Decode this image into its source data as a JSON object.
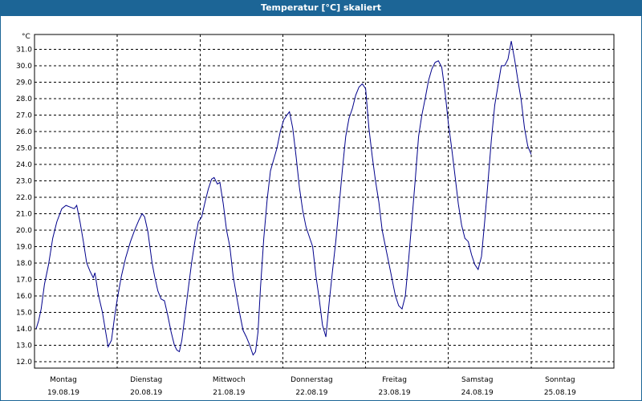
{
  "window": {
    "title": "Temperatur [°C] skaliert"
  },
  "chart_data": {
    "type": "line",
    "ylabel": "°C",
    "ylim": [
      11.6,
      31.9
    ],
    "xlim": [
      0,
      7
    ],
    "y_ticks": [
      "12.0",
      "13.0",
      "14.0",
      "15.0",
      "16.0",
      "17.0",
      "18.0",
      "19.0",
      "20.0",
      "21.0",
      "22.0",
      "23.0",
      "24.0",
      "25.0",
      "26.0",
      "27.0",
      "28.0",
      "29.0",
      "30.0",
      "31.0"
    ],
    "days": [
      {
        "weekday": "Montag",
        "date": "19.08.19"
      },
      {
        "weekday": "Dienstag",
        "date": "20.08.19"
      },
      {
        "weekday": "Mittwoch",
        "date": "21.08.19"
      },
      {
        "weekday": "Donnerstag",
        "date": "22.08.19"
      },
      {
        "weekday": "Freitag",
        "date": "23.08.19"
      },
      {
        "weekday": "Samstag",
        "date": "24.08.19"
      },
      {
        "weekday": "Sonntag",
        "date": "25.08.19"
      }
    ],
    "grid": true,
    "colors": {
      "line": "#00008b",
      "grid": "#000000",
      "frame": "#1c6596"
    },
    "series": [
      {
        "x_unit": "days since 19.08.19 00:00",
        "points": [
          [
            0.02,
            14.0
          ],
          [
            0.05,
            14.5
          ],
          [
            0.08,
            15.2
          ],
          [
            0.12,
            16.7
          ],
          [
            0.17,
            17.9
          ],
          [
            0.22,
            19.5
          ],
          [
            0.27,
            20.5
          ],
          [
            0.33,
            21.3
          ],
          [
            0.38,
            21.5
          ],
          [
            0.43,
            21.4
          ],
          [
            0.48,
            21.3
          ],
          [
            0.51,
            21.5
          ],
          [
            0.55,
            20.5
          ],
          [
            0.59,
            19.3
          ],
          [
            0.63,
            18.0
          ],
          [
            0.67,
            17.5
          ],
          [
            0.71,
            17.1
          ],
          [
            0.73,
            17.4
          ],
          [
            0.77,
            16.1
          ],
          [
            0.82,
            15.0
          ],
          [
            0.86,
            13.8
          ],
          [
            0.89,
            12.9
          ],
          [
            0.93,
            13.3
          ],
          [
            0.97,
            14.8
          ],
          [
            1.0,
            15.8
          ],
          [
            1.05,
            17.2
          ],
          [
            1.1,
            18.3
          ],
          [
            1.16,
            19.3
          ],
          [
            1.21,
            20.0
          ],
          [
            1.26,
            20.6
          ],
          [
            1.3,
            21.0
          ],
          [
            1.33,
            20.8
          ],
          [
            1.37,
            19.9
          ],
          [
            1.42,
            18.0
          ],
          [
            1.45,
            17.2
          ],
          [
            1.49,
            16.3
          ],
          [
            1.53,
            15.8
          ],
          [
            1.57,
            15.7
          ],
          [
            1.61,
            14.8
          ],
          [
            1.65,
            13.8
          ],
          [
            1.69,
            13.0
          ],
          [
            1.72,
            12.7
          ],
          [
            1.75,
            12.6
          ],
          [
            1.78,
            13.3
          ],
          [
            1.82,
            14.9
          ],
          [
            1.86,
            16.5
          ],
          [
            1.9,
            18.1
          ],
          [
            1.94,
            19.4
          ],
          [
            1.98,
            20.5
          ],
          [
            2.02,
            20.8
          ],
          [
            2.06,
            21.7
          ],
          [
            2.1,
            22.5
          ],
          [
            2.14,
            23.1
          ],
          [
            2.17,
            23.2
          ],
          [
            2.21,
            22.8
          ],
          [
            2.24,
            22.9
          ],
          [
            2.28,
            21.6
          ],
          [
            2.32,
            20.0
          ],
          [
            2.36,
            19.0
          ],
          [
            2.4,
            17.2
          ],
          [
            2.44,
            16.0
          ],
          [
            2.48,
            14.9
          ],
          [
            2.52,
            13.9
          ],
          [
            2.56,
            13.5
          ],
          [
            2.6,
            13.0
          ],
          [
            2.64,
            12.4
          ],
          [
            2.67,
            12.6
          ],
          [
            2.7,
            13.8
          ],
          [
            2.73,
            16.5
          ],
          [
            2.77,
            19.5
          ],
          [
            2.81,
            21.8
          ],
          [
            2.85,
            23.6
          ],
          [
            2.89,
            24.3
          ],
          [
            2.93,
            25.0
          ],
          [
            2.97,
            26.0
          ],
          [
            3.01,
            26.7
          ],
          [
            3.05,
            27.0
          ],
          [
            3.08,
            27.2
          ],
          [
            3.12,
            26.2
          ],
          [
            3.16,
            24.5
          ],
          [
            3.2,
            22.6
          ],
          [
            3.24,
            21.2
          ],
          [
            3.28,
            20.2
          ],
          [
            3.32,
            19.6
          ],
          [
            3.36,
            19.0
          ],
          [
            3.4,
            17.2
          ],
          [
            3.44,
            15.8
          ],
          [
            3.48,
            14.2
          ],
          [
            3.52,
            13.5
          ],
          [
            3.56,
            15.6
          ],
          [
            3.6,
            17.5
          ],
          [
            3.64,
            19.3
          ],
          [
            3.68,
            21.5
          ],
          [
            3.72,
            23.7
          ],
          [
            3.76,
            25.7
          ],
          [
            3.8,
            26.8
          ],
          [
            3.84,
            27.4
          ],
          [
            3.88,
            28.2
          ],
          [
            3.92,
            28.7
          ],
          [
            3.96,
            28.9
          ],
          [
            4.0,
            28.6
          ],
          [
            4.04,
            26.2
          ],
          [
            4.08,
            24.5
          ],
          [
            4.12,
            23.0
          ],
          [
            4.16,
            21.7
          ],
          [
            4.2,
            20.0
          ],
          [
            4.24,
            19.0
          ],
          [
            4.28,
            18.0
          ],
          [
            4.32,
            17.0
          ],
          [
            4.36,
            16.0
          ],
          [
            4.4,
            15.4
          ],
          [
            4.44,
            15.2
          ],
          [
            4.48,
            16.0
          ],
          [
            4.52,
            18.2
          ],
          [
            4.56,
            20.6
          ],
          [
            4.6,
            23.1
          ],
          [
            4.64,
            25.7
          ],
          [
            4.68,
            27.0
          ],
          [
            4.72,
            28.0
          ],
          [
            4.76,
            29.1
          ],
          [
            4.8,
            29.8
          ],
          [
            4.84,
            30.2
          ],
          [
            4.88,
            30.3
          ],
          [
            4.92,
            29.9
          ],
          [
            4.96,
            28.4
          ],
          [
            5.0,
            26.5
          ],
          [
            5.04,
            25.0
          ],
          [
            5.08,
            23.3
          ],
          [
            5.12,
            21.6
          ],
          [
            5.16,
            20.3
          ],
          [
            5.2,
            19.5
          ],
          [
            5.24,
            19.3
          ],
          [
            5.28,
            18.5
          ],
          [
            5.32,
            17.9
          ],
          [
            5.36,
            17.6
          ],
          [
            5.4,
            18.4
          ],
          [
            5.44,
            20.6
          ],
          [
            5.48,
            23.0
          ],
          [
            5.52,
            25.5
          ],
          [
            5.56,
            27.6
          ],
          [
            5.6,
            28.8
          ],
          [
            5.64,
            30.0
          ],
          [
            5.68,
            30.0
          ],
          [
            5.72,
            30.4
          ],
          [
            5.76,
            31.5
          ],
          [
            5.8,
            30.4
          ],
          [
            5.84,
            29.1
          ],
          [
            5.88,
            27.9
          ],
          [
            5.92,
            26.2
          ],
          [
            5.96,
            25.1
          ],
          [
            6.0,
            24.6
          ]
        ]
      }
    ]
  }
}
